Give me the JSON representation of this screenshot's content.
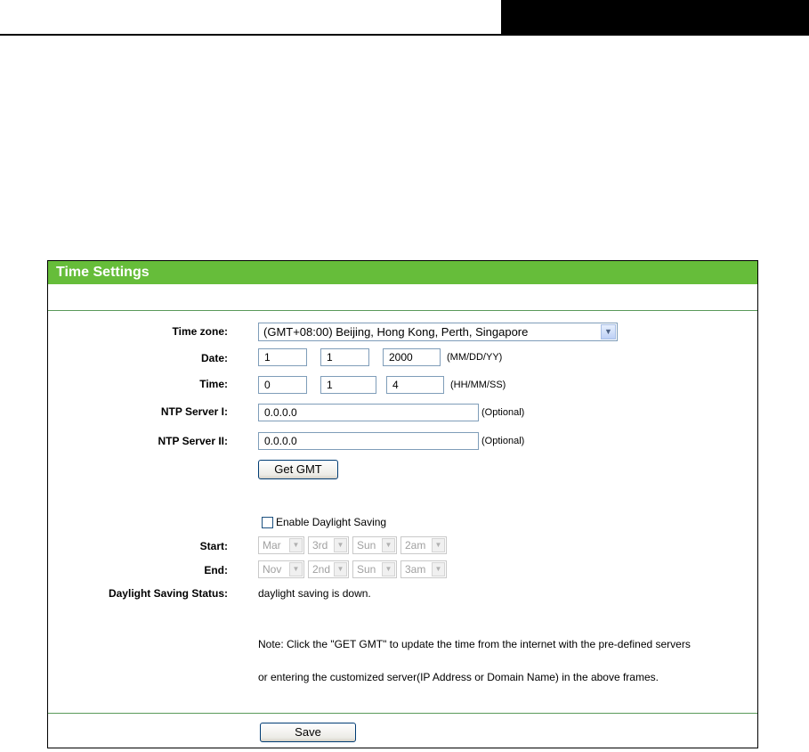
{
  "panel": {
    "title": "Time Settings"
  },
  "time_zone": {
    "label": "Time zone:",
    "value": "(GMT+08:00) Beijing, Hong Kong, Perth, Singapore"
  },
  "date": {
    "label": "Date:",
    "month": "1",
    "day": "1",
    "year": "2000",
    "format": "(MM/DD/YY)"
  },
  "time": {
    "label": "Time:",
    "hour": "0",
    "minute": "1",
    "second": "4",
    "format": "(HH/MM/SS)"
  },
  "ntp1": {
    "label": "NTP Server I:",
    "value": "0.0.0.0",
    "hint": "(Optional)"
  },
  "ntp2": {
    "label": "NTP Server II:",
    "value": "0.0.0.0",
    "hint": "(Optional)"
  },
  "get_gmt_label": "Get GMT",
  "daylight": {
    "checkbox_label": "Enable Daylight Saving",
    "checked": false,
    "start_label": "Start:",
    "start": [
      "Mar",
      "3rd",
      "Sun",
      "2am"
    ],
    "end_label": "End:",
    "end": [
      "Nov",
      "2nd",
      "Sun",
      "3am"
    ],
    "status_label": "Daylight Saving Status:",
    "status_value": "daylight saving is down."
  },
  "note": {
    "line1": "Note: Click the \"GET GMT\" to update the time from the internet with the pre-defined servers",
    "line2": "or entering the customized server(IP Address or Domain Name) in the above frames."
  },
  "save_label": "Save"
}
